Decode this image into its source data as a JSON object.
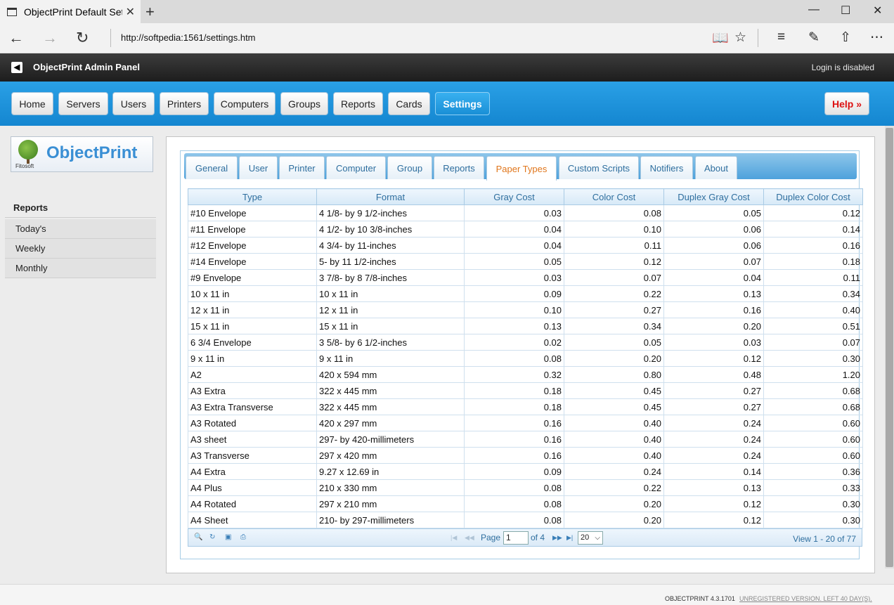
{
  "browser": {
    "tab_title": "ObjectPrint Default Sett",
    "url": "http://softpedia:1561/settings.htm"
  },
  "header": {
    "title": "ObjectPrint Admin Panel",
    "login_status": "Login is disabled"
  },
  "nav": {
    "items": [
      "Home",
      "Servers",
      "Users",
      "Printers",
      "Computers",
      "Groups",
      "Reports",
      "Cards",
      "Settings"
    ],
    "active": "Settings",
    "help_label": "Help »"
  },
  "logo": {
    "text": "ObjectPrint",
    "sub": "Fitosoft"
  },
  "sidebar": {
    "title": "Reports",
    "items": [
      "Today's",
      "Weekly",
      "Monthly"
    ]
  },
  "subtabs": {
    "items": [
      "General",
      "User",
      "Printer",
      "Computer",
      "Group",
      "Reports",
      "Paper Types",
      "Custom Scripts",
      "Notifiers",
      "About"
    ],
    "active": "Paper Types"
  },
  "grid": {
    "columns": [
      "Type",
      "Format",
      "Gray Cost",
      "Color Cost",
      "Duplex Gray Cost",
      "Duplex Color Cost"
    ],
    "rows": [
      [
        "#10 Envelope",
        "4 1/8- by 9 1/2-inches",
        "0.03",
        "0.08",
        "0.05",
        "0.12"
      ],
      [
        "#11 Envelope",
        "4 1/2- by 10 3/8-inches",
        "0.04",
        "0.10",
        "0.06",
        "0.14"
      ],
      [
        "#12 Envelope",
        "4 3/4- by 11-inches",
        "0.04",
        "0.11",
        "0.06",
        "0.16"
      ],
      [
        "#14 Envelope",
        "5- by 11 1/2-inches",
        "0.05",
        "0.12",
        "0.07",
        "0.18"
      ],
      [
        "#9 Envelope",
        "3 7/8- by 8 7/8-inches",
        "0.03",
        "0.07",
        "0.04",
        "0.11"
      ],
      [
        "10 x 11 in",
        "10 x 11 in",
        "0.09",
        "0.22",
        "0.13",
        "0.34"
      ],
      [
        "12 x 11 in",
        "12 x 11 in",
        "0.10",
        "0.27",
        "0.16",
        "0.40"
      ],
      [
        "15 x 11 in",
        "15 x 11 in",
        "0.13",
        "0.34",
        "0.20",
        "0.51"
      ],
      [
        "6 3/4 Envelope",
        "3 5/8- by 6 1/2-inches",
        "0.02",
        "0.05",
        "0.03",
        "0.07"
      ],
      [
        "9 x 11 in",
        "9 x 11 in",
        "0.08",
        "0.20",
        "0.12",
        "0.30"
      ],
      [
        "A2",
        "420 x 594 mm",
        "0.32",
        "0.80",
        "0.48",
        "1.20"
      ],
      [
        "A3 Extra",
        "322 x 445 mm",
        "0.18",
        "0.45",
        "0.27",
        "0.68"
      ],
      [
        "A3 Extra Transverse",
        "322 x 445 mm",
        "0.18",
        "0.45",
        "0.27",
        "0.68"
      ],
      [
        "A3 Rotated",
        "420 x 297 mm",
        "0.16",
        "0.40",
        "0.24",
        "0.60"
      ],
      [
        "A3 sheet",
        "297- by 420-millimeters",
        "0.16",
        "0.40",
        "0.24",
        "0.60"
      ],
      [
        "A3 Transverse",
        "297 x 420 mm",
        "0.16",
        "0.40",
        "0.24",
        "0.60"
      ],
      [
        "A4 Extra",
        "9.27 x 12.69 in",
        "0.09",
        "0.24",
        "0.14",
        "0.36"
      ],
      [
        "A4 Plus",
        "210 x 330 mm",
        "0.08",
        "0.22",
        "0.13",
        "0.33"
      ],
      [
        "A4 Rotated",
        "297 x 210 mm",
        "0.08",
        "0.20",
        "0.12",
        "0.30"
      ],
      [
        "A4 Sheet",
        "210- by 297-millimeters",
        "0.08",
        "0.20",
        "0.12",
        "0.30"
      ]
    ]
  },
  "pager": {
    "page_label": "Page",
    "page_value": "1",
    "of_label": "of 4",
    "rows_per_page": "20",
    "view_text": "View 1 - 20 of 77"
  },
  "footer": {
    "version": "OBJECTPRINT 4.3.1701",
    "unregistered": "UNREGISTERED VERSION. LEFT 40 DAY(S)."
  },
  "colors": {
    "nav_blue": "#1a8fd6",
    "active_subtab": "#e0761c",
    "help_red": "#dd1111"
  }
}
